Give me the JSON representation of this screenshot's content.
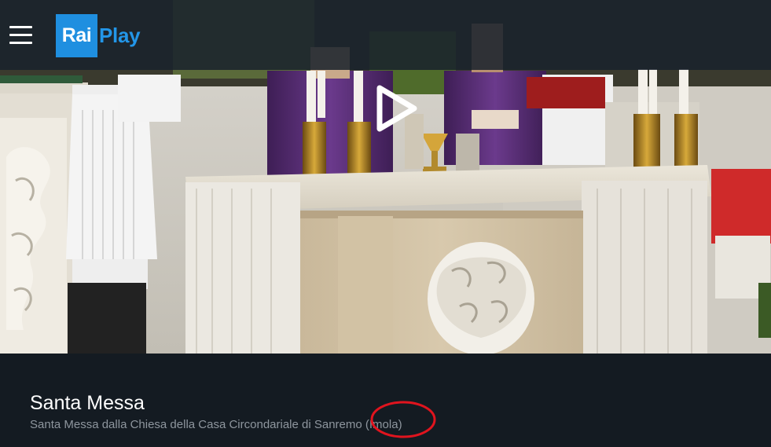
{
  "header": {
    "menu_icon": "hamburger-menu-icon",
    "logo": {
      "rai": "Rai",
      "play": "Play",
      "brand_color": "#1f8fe0"
    }
  },
  "player": {
    "play_icon": "play-icon"
  },
  "program": {
    "title": "Santa Messa",
    "description": "Santa Messa dalla Chiesa della Casa Circondariale di Sanremo (Imola)"
  },
  "colors": {
    "background": "#141b22",
    "header_overlay": "#18222c",
    "annotation": "#e0141e"
  }
}
